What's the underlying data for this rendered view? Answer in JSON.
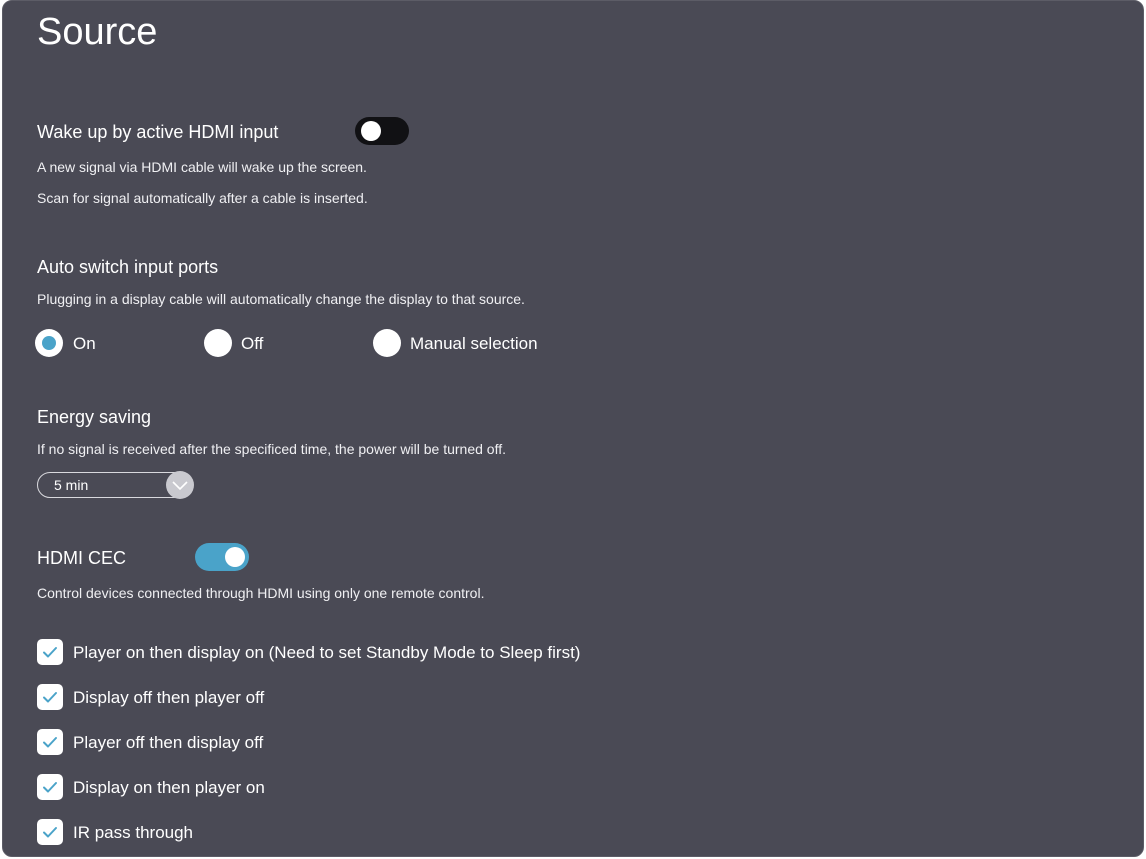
{
  "page": {
    "title": "Source"
  },
  "wake_hdmi": {
    "label": "Wake up by active HDMI input",
    "toggle_state": "off",
    "desc1": "A new signal via HDMI cable will wake up the screen.",
    "desc2": "Scan for signal automatically after a cable is inserted."
  },
  "auto_switch": {
    "label": "Auto switch input ports",
    "desc": "Plugging in a display cable will automatically change the display to that source.",
    "options": [
      "On",
      "Off",
      "Manual selection"
    ],
    "selected": "On"
  },
  "energy": {
    "label": "Energy saving",
    "desc": "If no signal is received after the specificed time, the power will be turned off.",
    "selected_value": "5 min"
  },
  "cec": {
    "label": "HDMI CEC",
    "toggle_state": "on",
    "desc": "Control devices connected through HDMI using only one remote control.",
    "checkboxes": [
      {
        "label": "Player on then display on (Need to set Standby Mode to Sleep first)",
        "checked": true
      },
      {
        "label": "Display off then player off",
        "checked": true
      },
      {
        "label": "Player off then display off",
        "checked": true
      },
      {
        "label": "Display on then player on",
        "checked": true
      },
      {
        "label": "IR pass through",
        "checked": true
      }
    ]
  },
  "colors": {
    "panel_bg": "#4a4a55",
    "accent": "#4aa3c9",
    "toggle_off": "#111114",
    "text": "#ffffff"
  }
}
